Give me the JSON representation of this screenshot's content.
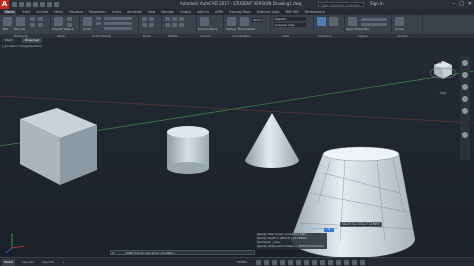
{
  "titlebar": {
    "logo": "A",
    "title": "Autodesk AutoCAD 2017 - STUDENT VERSION    Drawing1.dwg",
    "search_placeholder": "Type a keyword or phrase",
    "user": "Sign In",
    "minimize": "–",
    "maximize": "□",
    "close": "✕"
  },
  "ribbon_tabs": [
    "Home",
    "Solid",
    "Surface",
    "Mesh",
    "Visualize",
    "Parametric",
    "Insert",
    "Annotate",
    "View",
    "Manage",
    "Output",
    "Add-ins",
    "A360",
    "Express Tools",
    "Featured Apps",
    "BIM 360",
    "Performance"
  ],
  "ribbon_panels": [
    "Modeling",
    "Mesh",
    "Solid Editing",
    "Draw",
    "Modify",
    "Section",
    "Coordinates",
    "View",
    "Selection",
    "Layers",
    "Groups"
  ],
  "ribbon_labels": {
    "box": "Box",
    "extrude": "Extrude",
    "smooth_object": "Smooth Object",
    "union": "Union",
    "section_plane": "Section Plane",
    "culling": "Culling",
    "move_gizmo": "Move Gizmo",
    "layer_properties": "Layer Properties",
    "visual_style": "Realistic",
    "unsaved_view": "Unsaved View",
    "world": "World",
    "group": "Group"
  },
  "file_tabs": [
    "Start",
    "Drawing1"
  ],
  "viewport_label": "[-][Custom View][Realistic]",
  "viewcube": {
    "face": "TOP",
    "label": "WCS"
  },
  "command_history": [
    "Specify other corner or [Cube/Length]:",
    "Specify height or [2Point] <114.8930>:",
    "Command: _cone",
    "Specify center point of base or [3P/2P/Ttr/Elliptical]:",
    "Specify base radius or [Diameter] <114.8930>:"
  ],
  "command_prompt": "CONE Specify top radius <0.0000>:",
  "tooltip": "Specify top radius: 114.8930",
  "dynamic_input_value": "0",
  "status_tabs": [
    "Model",
    "Layout1",
    "Layout2",
    "+"
  ],
  "status_model_label": "MODEL",
  "colors": {
    "accent": "#c8281e",
    "viewport_bg": "#1f252d",
    "ribbon_bg": "#3b424b",
    "solid_fill": "#b8c4cc",
    "dynamic_input": "#3b7fd0"
  }
}
